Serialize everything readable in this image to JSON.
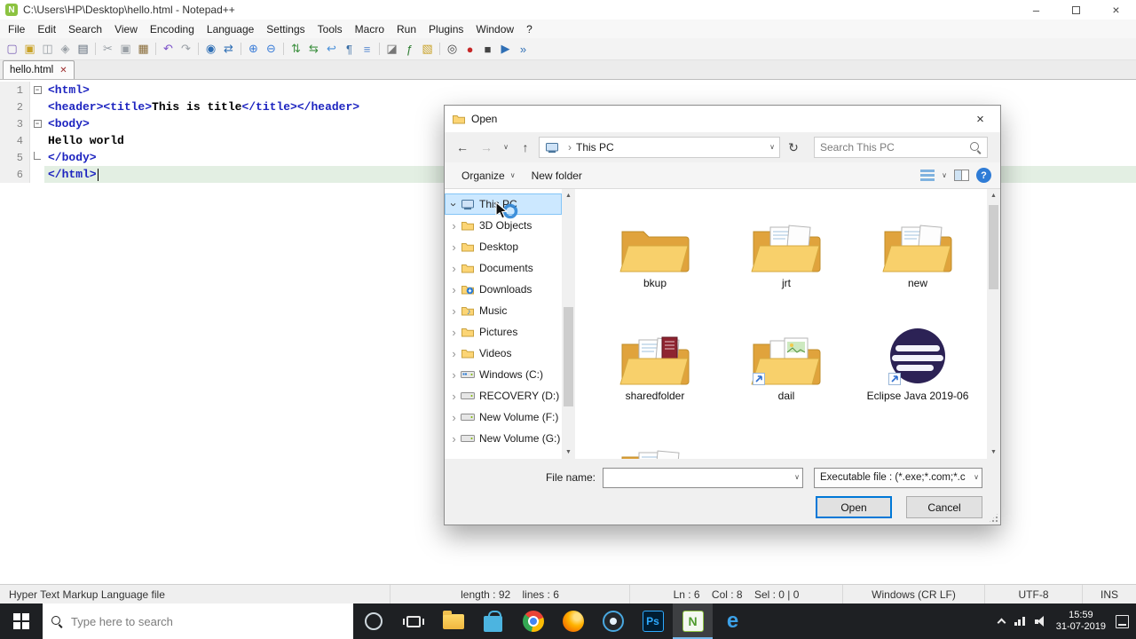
{
  "notepad": {
    "window_title": "C:\\Users\\HP\\Desktop\\hello.html - Notepad++",
    "menu_items": [
      "File",
      "Edit",
      "Search",
      "View",
      "Encoding",
      "Language",
      "Settings",
      "Tools",
      "Macro",
      "Run",
      "Plugins",
      "Window",
      "?"
    ],
    "toolbar_icons": [
      {
        "name": "new-file",
        "glyph": "▢",
        "color": "#7a5fb5"
      },
      {
        "name": "open-file",
        "glyph": "▣",
        "color": "#c9a227"
      },
      {
        "name": "save-file",
        "glyph": "◫",
        "color": "#9aa0a6"
      },
      {
        "name": "save-all",
        "glyph": "◈",
        "color": "#9aa0a6"
      },
      {
        "name": "print",
        "glyph": "▤",
        "color": "#5f6b7a"
      },
      {
        "sep": true
      },
      {
        "name": "cut",
        "glyph": "✂",
        "color": "#9aa0a6"
      },
      {
        "name": "copy",
        "glyph": "▣",
        "color": "#9aa0a6"
      },
      {
        "name": "paste",
        "glyph": "▦",
        "color": "#8a6d3b"
      },
      {
        "sep": true
      },
      {
        "name": "undo",
        "glyph": "↶",
        "color": "#7b51c9"
      },
      {
        "name": "redo",
        "glyph": "↷",
        "color": "#9aa0a6"
      },
      {
        "sep": true
      },
      {
        "name": "find",
        "glyph": "◉",
        "color": "#2f6fb5"
      },
      {
        "name": "replace",
        "glyph": "⇄",
        "color": "#2f6fb5"
      },
      {
        "sep": true
      },
      {
        "name": "zoom-in",
        "glyph": "⊕",
        "color": "#3b7dd8"
      },
      {
        "name": "zoom-out",
        "glyph": "⊖",
        "color": "#3b7dd8"
      },
      {
        "sep": true
      },
      {
        "name": "sync-vertical-scroll",
        "glyph": "⇅",
        "color": "#3f9142"
      },
      {
        "name": "sync-horizontal-scroll",
        "glyph": "⇆",
        "color": "#3f9142"
      },
      {
        "name": "word-wrap",
        "glyph": "↩",
        "color": "#4a90d9"
      },
      {
        "name": "show-all-characters",
        "glyph": "¶",
        "color": "#3a6ea5"
      },
      {
        "name": "indent-guide",
        "glyph": "≡",
        "color": "#5b8bd0"
      },
      {
        "sep": true
      },
      {
        "name": "document-map",
        "glyph": "◪",
        "color": "#777777"
      },
      {
        "name": "function-list",
        "glyph": "ƒ",
        "color": "#2e7d32"
      },
      {
        "name": "folder-as-workspace",
        "glyph": "▧",
        "color": "#c9a227"
      },
      {
        "sep": true
      },
      {
        "name": "monitoring",
        "glyph": "◎",
        "color": "#444444"
      },
      {
        "name": "record-macro",
        "glyph": "●",
        "color": "#c62828"
      },
      {
        "name": "stop-macro",
        "glyph": "■",
        "color": "#444444"
      },
      {
        "name": "play-macro",
        "glyph": "▶",
        "color": "#2f6fb5"
      },
      {
        "name": "run-macro-multiple",
        "glyph": "»",
        "color": "#2f6fb5"
      }
    ],
    "tab_label": "hello.html",
    "editor_lines": [
      {
        "n": 1,
        "fold": "box",
        "segs": [
          {
            "c": "tag",
            "t": "<html>"
          }
        ]
      },
      {
        "n": 2,
        "fold": "none",
        "segs": [
          {
            "c": "tag",
            "t": "<header><title>"
          },
          {
            "c": "txt",
            "t": "This is title"
          },
          {
            "c": "tag",
            "t": "</title></header>"
          }
        ]
      },
      {
        "n": 3,
        "fold": "box",
        "segs": [
          {
            "c": "tag",
            "t": "<body>"
          }
        ]
      },
      {
        "n": 4,
        "fold": "none",
        "segs": [
          {
            "c": "txt",
            "t": "Hello world"
          }
        ]
      },
      {
        "n": 5,
        "fold": "end",
        "segs": [
          {
            "c": "tag",
            "t": "</body>"
          }
        ]
      },
      {
        "n": 6,
        "fold": "none",
        "current": true,
        "segs": [
          {
            "c": "tag",
            "t": "</html>"
          }
        ]
      }
    ],
    "status": {
      "doc_type": "Hyper Text Markup Language file",
      "length_info": "length : 92    lines : 6",
      "caret_info": "Ln : 6    Col : 8    Sel : 0 | 0",
      "eol": "Windows (CR LF)",
      "encoding": "UTF-8",
      "insert_mode": "INS"
    }
  },
  "dialog": {
    "title": "Open",
    "breadcrumb": {
      "location": "This PC"
    },
    "search_placeholder": "Search This PC",
    "toolbar": {
      "organize": "Organize",
      "new_folder": "New folder"
    },
    "sidebar": [
      {
        "label": "This PC",
        "icon": "pc",
        "expanded": true,
        "selected": true
      },
      {
        "label": "3D Objects",
        "icon": "folder"
      },
      {
        "label": "Desktop",
        "icon": "folder"
      },
      {
        "label": "Documents",
        "icon": "folder"
      },
      {
        "label": "Downloads",
        "icon": "download"
      },
      {
        "label": "Music",
        "icon": "music"
      },
      {
        "label": "Pictures",
        "icon": "folder"
      },
      {
        "label": "Videos",
        "icon": "folder"
      },
      {
        "label": "Windows (C:)",
        "icon": "drive-win"
      },
      {
        "label": "RECOVERY (D:)",
        "icon": "drive"
      },
      {
        "label": "New Volume (F:)",
        "icon": "drive"
      },
      {
        "label": "New Volume (G:)",
        "icon": "drive"
      }
    ],
    "files": [
      {
        "label": "bkup",
        "icon": "folder-empty"
      },
      {
        "label": "jrt",
        "icon": "folder-docs"
      },
      {
        "label": "new",
        "icon": "folder-docs"
      },
      {
        "label": "sharedfolder",
        "icon": "folder-red-doc"
      },
      {
        "label": "dail",
        "icon": "folder-pic",
        "shortcut": true
      },
      {
        "label": "Eclipse Java 2019-06",
        "icon": "eclipse",
        "shortcut": true
      },
      {
        "label": "",
        "icon": "folder-docs",
        "partial": true
      }
    ],
    "footer": {
      "file_name_label": "File name:",
      "file_name_value": "",
      "file_type": "Executable file :  (*.exe;*.com;*.c",
      "open_label": "Open",
      "cancel_label": "Cancel"
    }
  },
  "taskbar": {
    "search_placeholder": "Type here to search",
    "apps": [
      {
        "name": "file-explorer"
      },
      {
        "name": "store"
      },
      {
        "name": "chrome"
      },
      {
        "name": "firefox"
      },
      {
        "name": "media-player"
      },
      {
        "name": "photoshop"
      },
      {
        "name": "notepad-plus-plus",
        "active": true
      },
      {
        "name": "edge"
      }
    ],
    "clock": {
      "time": "15:59",
      "date": "31-07-2019"
    }
  }
}
